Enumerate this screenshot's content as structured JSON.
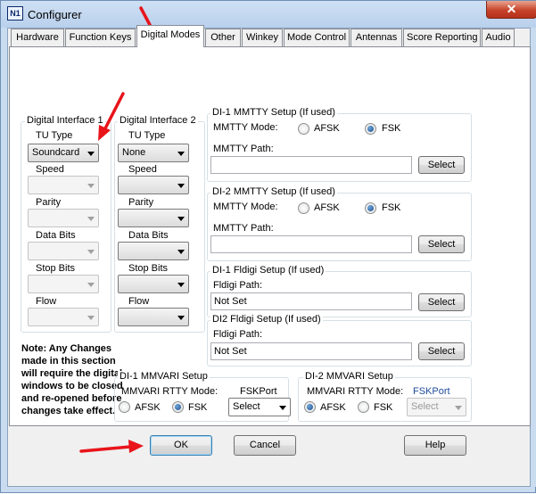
{
  "window": {
    "title": "Configurer",
    "icon_text": "N1",
    "close_label": "✕"
  },
  "tabs": [
    "Hardware",
    "Function Keys",
    "Digital Modes",
    "Other",
    "Winkey",
    "Mode Control",
    "Antennas",
    "Score Reporting",
    "Audio"
  ],
  "active_tab": "Digital Modes",
  "di1": {
    "label": "Digital Interface 1",
    "tu_type_label": "TU Type",
    "tu_type_value": "Soundcard",
    "speed_label": "Speed",
    "parity_label": "Parity",
    "databits_label": "Data Bits",
    "stopbits_label": "Stop Bits",
    "flow_label": "Flow"
  },
  "di2": {
    "label": "Digital Interface 2",
    "tu_type_label": "TU Type",
    "tu_type_value": "None",
    "speed_label": "Speed",
    "parity_label": "Parity",
    "databits_label": "Data Bits",
    "stopbits_label": "Stop Bits",
    "flow_label": "Flow"
  },
  "mmtty1": {
    "title": "DI-1 MMTTY Setup (If used)",
    "mode_label": "MMTTY Mode:",
    "afsk": "AFSK",
    "fsk": "FSK",
    "selected": "FSK",
    "path_label": "MMTTY Path:",
    "path_value": "",
    "select": "Select"
  },
  "mmtty2": {
    "title": "DI-2 MMTTY Setup (If used)",
    "mode_label": "MMTTY Mode:",
    "afsk": "AFSK",
    "fsk": "FSK",
    "selected": "FSK",
    "path_label": "MMTTY Path:",
    "path_value": "",
    "select": "Select"
  },
  "fldigi1": {
    "title": "DI-1 Fldigi Setup (If used)",
    "path_label": "Fldigi Path:",
    "path_value": "Not Set",
    "select": "Select"
  },
  "fldigi2": {
    "title": "DI2 Fldigi Setup (If used)",
    "path_label": "Fldigi Path:",
    "path_value": "Not Set",
    "select": "Select"
  },
  "note": "Note: Any Changes made in this section will require the digital windows to be closed and re-opened before changes take effect.",
  "mmvari1": {
    "title": "DI-1 MMVARI Setup",
    "mode_label": "MMVARI RTTY Mode:",
    "fskport_label": "FSKPort",
    "afsk": "AFSK",
    "fsk": "FSK",
    "selected": "FSK",
    "port_value": "Select"
  },
  "mmvari2": {
    "title": "DI-2 MMVARI Setup",
    "mode_label": "MMVARI RTTY Mode:",
    "fskport_label": "FSKPort",
    "afsk": "AFSK",
    "fsk": "FSK",
    "selected": "AFSK",
    "port_value": "Select"
  },
  "buttons": {
    "ok": "OK",
    "cancel": "Cancel",
    "help": "Help"
  },
  "colors": {
    "annotation_arrow": "#e8141a",
    "title_bar": "#b9d0ec"
  }
}
